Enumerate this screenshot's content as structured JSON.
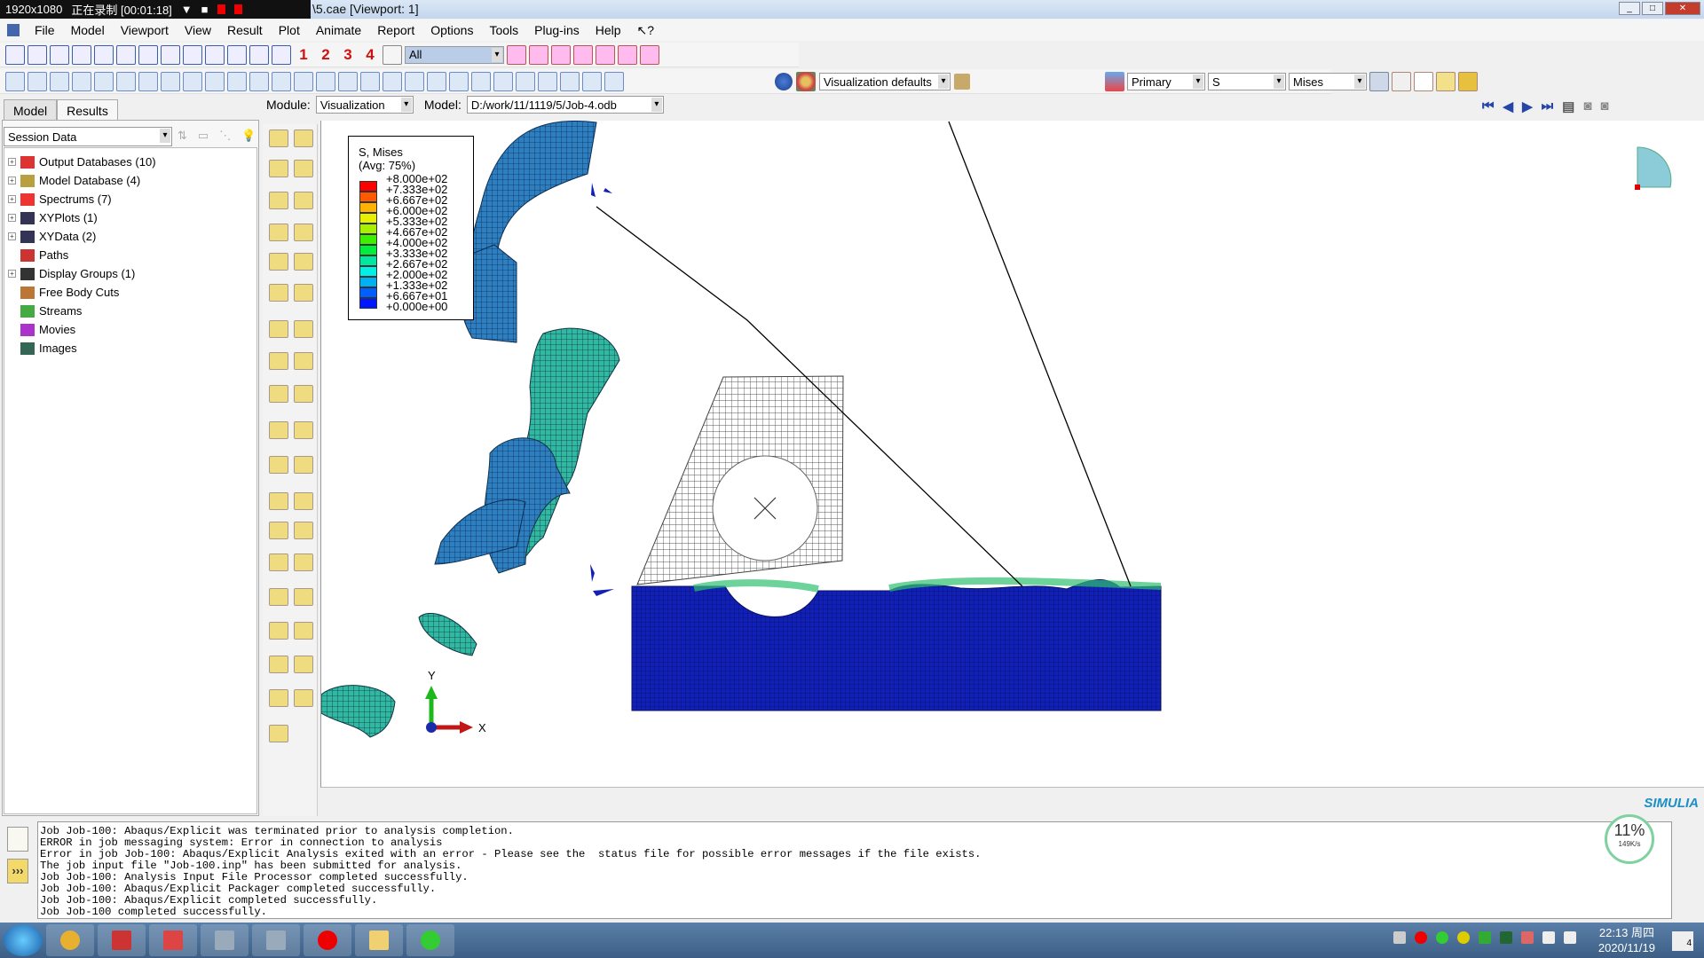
{
  "recorder": {
    "resolution": "1920x1080",
    "status": "正在录制 [00:01:18]"
  },
  "window": {
    "title": "\\5.cae [Viewport: 1]"
  },
  "menu": [
    "File",
    "Model",
    "Viewport",
    "View",
    "Result",
    "Plot",
    "Animate",
    "Report",
    "Options",
    "Tools",
    "Plug-ins",
    "Help",
    "↖?"
  ],
  "toolbar": {
    "view_numbers": [
      "1",
      "2",
      "3",
      "4"
    ],
    "selection_filter": "All",
    "color_code": "Visualization defaults",
    "primary": "Primary",
    "variable": "S",
    "invariant": "Mises"
  },
  "left_tabs": [
    {
      "label": "Model",
      "active": false
    },
    {
      "label": "Results",
      "active": true
    }
  ],
  "session_select": "Session Data",
  "tree": [
    {
      "label": "Output Databases (10)",
      "expandable": true,
      "icon": "odb-icon",
      "color": "#d33"
    },
    {
      "label": "Model Database (4)",
      "expandable": true,
      "icon": "database-icon",
      "color": "#b8a040"
    },
    {
      "label": "Spectrums (7)",
      "expandable": true,
      "icon": "spectrum-icon",
      "color": "#e33"
    },
    {
      "label": "XYPlots (1)",
      "expandable": true,
      "icon": "xyplot-icon",
      "color": "#335"
    },
    {
      "label": "XYData (2)",
      "expandable": true,
      "icon": "xydata-icon",
      "color": "#335"
    },
    {
      "label": "Paths",
      "expandable": false,
      "icon": "path-icon",
      "color": "#c33"
    },
    {
      "label": "Display Groups (1)",
      "expandable": true,
      "icon": "display-group-icon",
      "color": "#333"
    },
    {
      "label": "Free Body Cuts",
      "expandable": false,
      "icon": "free-body-cut-icon",
      "color": "#b73"
    },
    {
      "label": "Streams",
      "expandable": false,
      "icon": "stream-icon",
      "color": "#4a4"
    },
    {
      "label": "Movies",
      "expandable": false,
      "icon": "movie-icon",
      "color": "#a3c"
    },
    {
      "label": "Images",
      "expandable": false,
      "icon": "image-icon",
      "color": "#365"
    }
  ],
  "module_bar": {
    "module_label": "Module:",
    "module_value": "Visualization",
    "model_label": "Model:",
    "model_value": "D:/work/11/1119/5/Job-4.odb"
  },
  "legend": {
    "title": "S, Mises",
    "subtitle": "(Avg: 75%)",
    "values": [
      "+8.000e+02",
      "+7.333e+02",
      "+6.667e+02",
      "+6.000e+02",
      "+5.333e+02",
      "+4.667e+02",
      "+4.000e+02",
      "+3.333e+02",
      "+2.667e+02",
      "+2.000e+02",
      "+1.333e+02",
      "+6.667e+01",
      "+0.000e+00"
    ],
    "colors": [
      "#ff0000",
      "#ff5a00",
      "#ffb300",
      "#e6f000",
      "#a6f000",
      "#3cf000",
      "#00ee3c",
      "#00e8a0",
      "#00f0e6",
      "#00b0f0",
      "#0060ff",
      "#0018ff"
    ]
  },
  "triad": {
    "x": "X",
    "y": "Y"
  },
  "messages": [
    "Job Job-100: Abaqus/Explicit was terminated prior to analysis completion.",
    "ERROR in job messaging system: Error in connection to analysis",
    "Error in job Job-100: Abaqus/Explicit Analysis exited with an error - Please see the  status file for possible error messages if the file exists.",
    "The job input file \"Job-100.inp\" has been submitted for analysis.",
    "Job Job-100: Analysis Input File Processor completed successfully.",
    "Job Job-100: Abaqus/Explicit Packager completed successfully.",
    "Job Job-100: Abaqus/Explicit completed successfully.",
    "Job Job-100 completed successfully."
  ],
  "brand": "SIMULIA",
  "net_widget": {
    "percent": "11%",
    "speed": "149K/s"
  },
  "clock": {
    "time": "22:13 周四",
    "date": "2020/11/19"
  },
  "notification_count": "4"
}
